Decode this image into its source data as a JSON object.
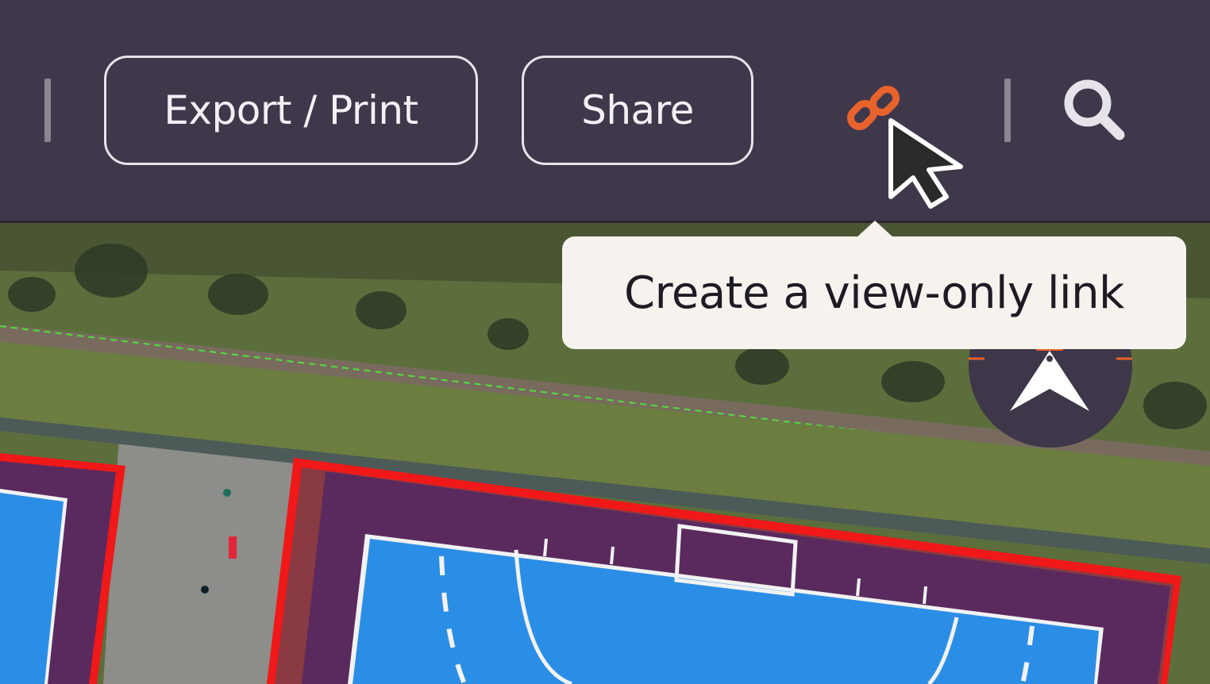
{
  "toolbar": {
    "export_print_label": "Export / Print",
    "share_label": "Share",
    "link_icon": "link-icon",
    "search_icon": "search-icon"
  },
  "tooltip": {
    "text": "Create a view-only link"
  },
  "colors": {
    "toolbar_bg": "#3f384b",
    "link_icon": "#e8622c",
    "court_blue": "#2b8ee6",
    "court_purple": "#5a2a5e",
    "boundary_red": "#f01818"
  },
  "map": {
    "compass_icon": "compass-north-icon"
  }
}
